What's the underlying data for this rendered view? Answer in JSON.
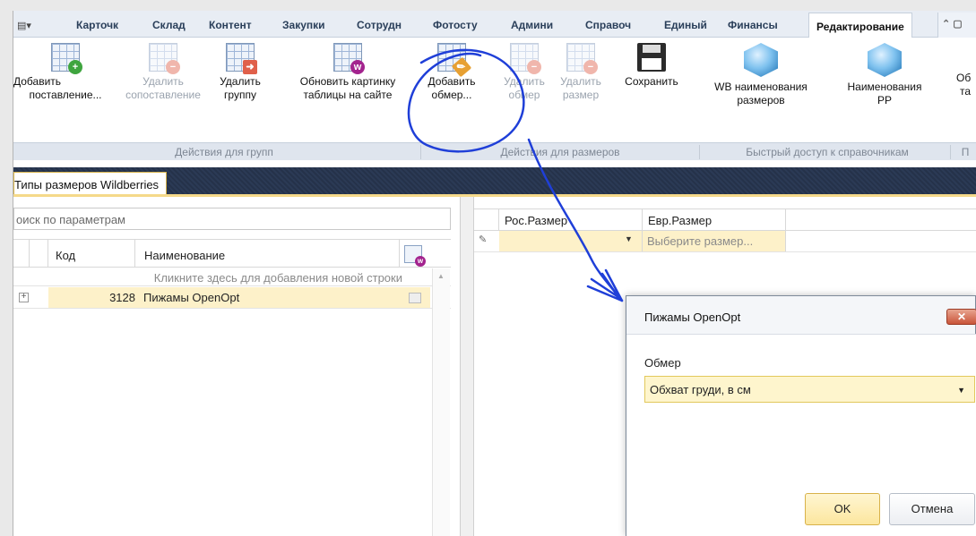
{
  "ribbon": {
    "tabs": [
      "Карточк",
      "Склад",
      "Контент",
      "Закупки",
      "Сотрудн",
      "Фотосту",
      "Админи",
      "Справоч",
      "Единый",
      "Финансы"
    ],
    "active_tab": "Редактирование",
    "buttons": {
      "add_mapping": {
        "line1": "Добавить",
        "line2": "поставление..."
      },
      "del_mapping": {
        "line1": "Удалить",
        "line2": "сопоставление"
      },
      "del_group": {
        "line1": "Удалить",
        "line2": "группу"
      },
      "refresh_image": {
        "line1": "Обновить картинку",
        "line2": "таблицы на сайте"
      },
      "add_measure": {
        "line1": "Добавить",
        "line2": "обмер..."
      },
      "del_measure": {
        "line1": "Удалить",
        "line2": "обмер"
      },
      "del_size": {
        "line1": "Удалить",
        "line2": "размер"
      },
      "save": {
        "line1": "Сохранить",
        "line2": ""
      },
      "wb_names": {
        "line1": "WB наименования",
        "line2": "размеров"
      },
      "rf_names": {
        "line1": "Наименования",
        "line2": "РР"
      },
      "more": {
        "line1": "Об",
        "line2": "та"
      }
    },
    "groups": [
      "Действия для групп",
      "Действия для размеров",
      "Быстрый доступ к справочникам",
      "П"
    ]
  },
  "doc_tab": "Типы размеров Wildberries",
  "left": {
    "search_placeholder": "оиск по параметрам",
    "columns": [
      "Код",
      "Наименование"
    ],
    "new_row_hint": "Кликните здесь для добавления новой строки",
    "rows": [
      {
        "code": "3128",
        "name": "Пижамы OpenOpt"
      }
    ]
  },
  "right": {
    "columns": [
      "Рос.Размер",
      "Евр.Размер"
    ],
    "row": {
      "ros": "",
      "eur": "Выберите размер..."
    }
  },
  "dialog": {
    "title": "Пижамы OpenOpt",
    "close": "✕",
    "label": "Обмер",
    "value": "Обхват груди, в см",
    "ok": "OK",
    "cancel": "Отмена"
  },
  "colors": {
    "accent": "#fdf1c9",
    "annotation": "#1f3fd8",
    "ribbon_text": "#2a3f5a"
  },
  "icons": [
    "add-table-icon",
    "remove-table-icon",
    "group-arrow-icon",
    "wb-table-icon",
    "edit-table-icon",
    "floppy-disk-icon",
    "cube-icon",
    "pencil-icon"
  ]
}
